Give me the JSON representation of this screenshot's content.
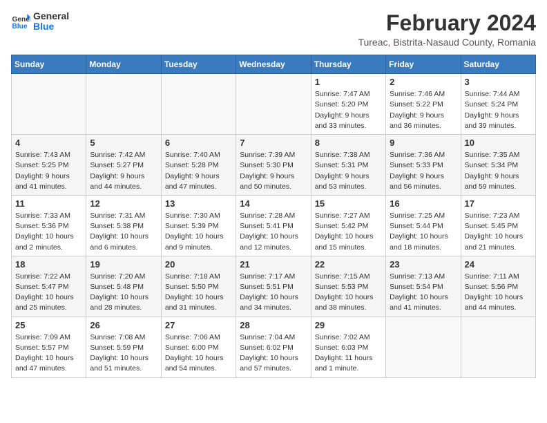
{
  "logo": {
    "line1": "General",
    "line2": "Blue"
  },
  "title": "February 2024",
  "location": "Tureac, Bistrita-Nasaud County, Romania",
  "weekdays": [
    "Sunday",
    "Monday",
    "Tuesday",
    "Wednesday",
    "Thursday",
    "Friday",
    "Saturday"
  ],
  "weeks": [
    [
      {
        "day": "",
        "info": ""
      },
      {
        "day": "",
        "info": ""
      },
      {
        "day": "",
        "info": ""
      },
      {
        "day": "",
        "info": ""
      },
      {
        "day": "1",
        "info": "Sunrise: 7:47 AM\nSunset: 5:20 PM\nDaylight: 9 hours\nand 33 minutes."
      },
      {
        "day": "2",
        "info": "Sunrise: 7:46 AM\nSunset: 5:22 PM\nDaylight: 9 hours\nand 36 minutes."
      },
      {
        "day": "3",
        "info": "Sunrise: 7:44 AM\nSunset: 5:24 PM\nDaylight: 9 hours\nand 39 minutes."
      }
    ],
    [
      {
        "day": "4",
        "info": "Sunrise: 7:43 AM\nSunset: 5:25 PM\nDaylight: 9 hours\nand 41 minutes."
      },
      {
        "day": "5",
        "info": "Sunrise: 7:42 AM\nSunset: 5:27 PM\nDaylight: 9 hours\nand 44 minutes."
      },
      {
        "day": "6",
        "info": "Sunrise: 7:40 AM\nSunset: 5:28 PM\nDaylight: 9 hours\nand 47 minutes."
      },
      {
        "day": "7",
        "info": "Sunrise: 7:39 AM\nSunset: 5:30 PM\nDaylight: 9 hours\nand 50 minutes."
      },
      {
        "day": "8",
        "info": "Sunrise: 7:38 AM\nSunset: 5:31 PM\nDaylight: 9 hours\nand 53 minutes."
      },
      {
        "day": "9",
        "info": "Sunrise: 7:36 AM\nSunset: 5:33 PM\nDaylight: 9 hours\nand 56 minutes."
      },
      {
        "day": "10",
        "info": "Sunrise: 7:35 AM\nSunset: 5:34 PM\nDaylight: 9 hours\nand 59 minutes."
      }
    ],
    [
      {
        "day": "11",
        "info": "Sunrise: 7:33 AM\nSunset: 5:36 PM\nDaylight: 10 hours\nand 2 minutes."
      },
      {
        "day": "12",
        "info": "Sunrise: 7:31 AM\nSunset: 5:38 PM\nDaylight: 10 hours\nand 6 minutes."
      },
      {
        "day": "13",
        "info": "Sunrise: 7:30 AM\nSunset: 5:39 PM\nDaylight: 10 hours\nand 9 minutes."
      },
      {
        "day": "14",
        "info": "Sunrise: 7:28 AM\nSunset: 5:41 PM\nDaylight: 10 hours\nand 12 minutes."
      },
      {
        "day": "15",
        "info": "Sunrise: 7:27 AM\nSunset: 5:42 PM\nDaylight: 10 hours\nand 15 minutes."
      },
      {
        "day": "16",
        "info": "Sunrise: 7:25 AM\nSunset: 5:44 PM\nDaylight: 10 hours\nand 18 minutes."
      },
      {
        "day": "17",
        "info": "Sunrise: 7:23 AM\nSunset: 5:45 PM\nDaylight: 10 hours\nand 21 minutes."
      }
    ],
    [
      {
        "day": "18",
        "info": "Sunrise: 7:22 AM\nSunset: 5:47 PM\nDaylight: 10 hours\nand 25 minutes."
      },
      {
        "day": "19",
        "info": "Sunrise: 7:20 AM\nSunset: 5:48 PM\nDaylight: 10 hours\nand 28 minutes."
      },
      {
        "day": "20",
        "info": "Sunrise: 7:18 AM\nSunset: 5:50 PM\nDaylight: 10 hours\nand 31 minutes."
      },
      {
        "day": "21",
        "info": "Sunrise: 7:17 AM\nSunset: 5:51 PM\nDaylight: 10 hours\nand 34 minutes."
      },
      {
        "day": "22",
        "info": "Sunrise: 7:15 AM\nSunset: 5:53 PM\nDaylight: 10 hours\nand 38 minutes."
      },
      {
        "day": "23",
        "info": "Sunrise: 7:13 AM\nSunset: 5:54 PM\nDaylight: 10 hours\nand 41 minutes."
      },
      {
        "day": "24",
        "info": "Sunrise: 7:11 AM\nSunset: 5:56 PM\nDaylight: 10 hours\nand 44 minutes."
      }
    ],
    [
      {
        "day": "25",
        "info": "Sunrise: 7:09 AM\nSunset: 5:57 PM\nDaylight: 10 hours\nand 47 minutes."
      },
      {
        "day": "26",
        "info": "Sunrise: 7:08 AM\nSunset: 5:59 PM\nDaylight: 10 hours\nand 51 minutes."
      },
      {
        "day": "27",
        "info": "Sunrise: 7:06 AM\nSunset: 6:00 PM\nDaylight: 10 hours\nand 54 minutes."
      },
      {
        "day": "28",
        "info": "Sunrise: 7:04 AM\nSunset: 6:02 PM\nDaylight: 10 hours\nand 57 minutes."
      },
      {
        "day": "29",
        "info": "Sunrise: 7:02 AM\nSunset: 6:03 PM\nDaylight: 11 hours\nand 1 minute."
      },
      {
        "day": "",
        "info": ""
      },
      {
        "day": "",
        "info": ""
      }
    ]
  ]
}
